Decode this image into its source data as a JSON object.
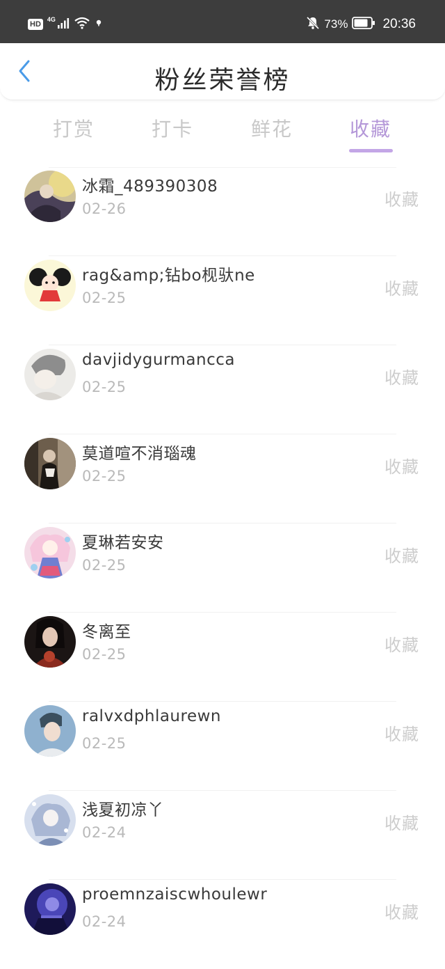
{
  "status_bar": {
    "hd": "HD",
    "network": "4G",
    "battery": "73%",
    "time": "20:36",
    "icons": [
      "hd-icon",
      "signal-icon",
      "wifi-icon",
      "notification-dot-icon",
      "mute-bell-icon",
      "battery-icon"
    ]
  },
  "header": {
    "title": "粉丝荣誉榜",
    "back_icon": "chevron-left-icon"
  },
  "tabs": [
    {
      "label": "打赏"
    },
    {
      "label": "打卡"
    },
    {
      "label": "鲜花"
    },
    {
      "label": "收藏"
    }
  ],
  "active_tab": "收藏",
  "colors": {
    "accent": "#c3a6e6",
    "back_arrow": "#4a9be8",
    "status_bar": "#3d3d3d"
  },
  "list": [
    {
      "name": "冰霜_489390308",
      "date": "02-26",
      "action": "收藏"
    },
    {
      "name": "rag&amp;钻bo枧驮ne",
      "date": "02-25",
      "action": "收藏"
    },
    {
      "name": "davjidygurmancca",
      "date": "02-25",
      "action": "收藏"
    },
    {
      "name": "莫道喧不消瑙魂",
      "date": "02-25",
      "action": "收藏"
    },
    {
      "name": "夏琳若安安",
      "date": "02-25",
      "action": "收藏"
    },
    {
      "name": "冬离至",
      "date": "02-25",
      "action": "收藏"
    },
    {
      "name": "ralvxdphlaurewn",
      "date": "02-25",
      "action": "收藏"
    },
    {
      "name": "浅夏初凉丫",
      "date": "02-24",
      "action": "收藏"
    },
    {
      "name": "proemnzaiscwhoulewr",
      "date": "02-24",
      "action": "收藏"
    }
  ]
}
